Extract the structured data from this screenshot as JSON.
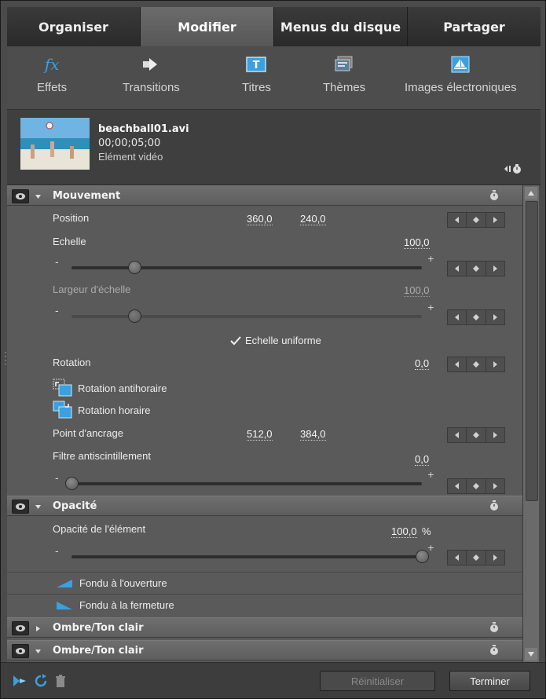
{
  "tabs": [
    "Organiser",
    "Modifier",
    "Menus du disque",
    "Partager"
  ],
  "toolbar": {
    "effects": "Effets",
    "transitions": "Transitions",
    "titles": "Titres",
    "themes": "Thèmes",
    "clipart": "Images électroniques",
    "effects_icon_text": "fx"
  },
  "clip": {
    "name": "beachball01.avi",
    "time": "00;00;05;00",
    "type": "Elément vidéo"
  },
  "motion": {
    "title": "Mouvement",
    "position_label": "Position",
    "position_x": "360,0",
    "position_y": "240,0",
    "scale_label": "Echelle",
    "scale_value": "100,0",
    "scale_width_label": "Largeur d'échelle",
    "scale_width_value": "100,0",
    "uniform_scale_label": "Echelle uniforme",
    "rotation_label": "Rotation",
    "rotation_value": "0,0",
    "rotate_ccw_label": "Rotation antihoraire",
    "rotate_cw_label": "Rotation horaire",
    "anchor_label": "Point d'ancrage",
    "anchor_x": "512,0",
    "anchor_y": "384,0",
    "flicker_label": "Filtre antiscintillement",
    "flicker_value": "0,0",
    "scale_slider_fraction": 0.18,
    "scale_width_slider_fraction": 0.18,
    "flicker_slider_fraction": 0.0
  },
  "opacity": {
    "title": "Opacité",
    "clip_opacity_label": "Opacité de l'élément",
    "clip_opacity_value": "100,0",
    "unit": "%",
    "slider_fraction": 1.0,
    "fade_in_label": "Fondu à l'ouverture",
    "fade_out_label": "Fondu à la fermeture"
  },
  "shadow1": {
    "title": "Ombre/Ton clair"
  },
  "shadow2": {
    "title": "Ombre/Ton clair"
  },
  "slider_signs": {
    "minus": "-",
    "plus": "+"
  },
  "buttons": {
    "reset": "Réinitialiser",
    "done": "Terminer"
  },
  "colors": {
    "accent_blue": "#3aa0e0",
    "panel_bg": "#5a5a5a",
    "header_bg": "#666666"
  }
}
